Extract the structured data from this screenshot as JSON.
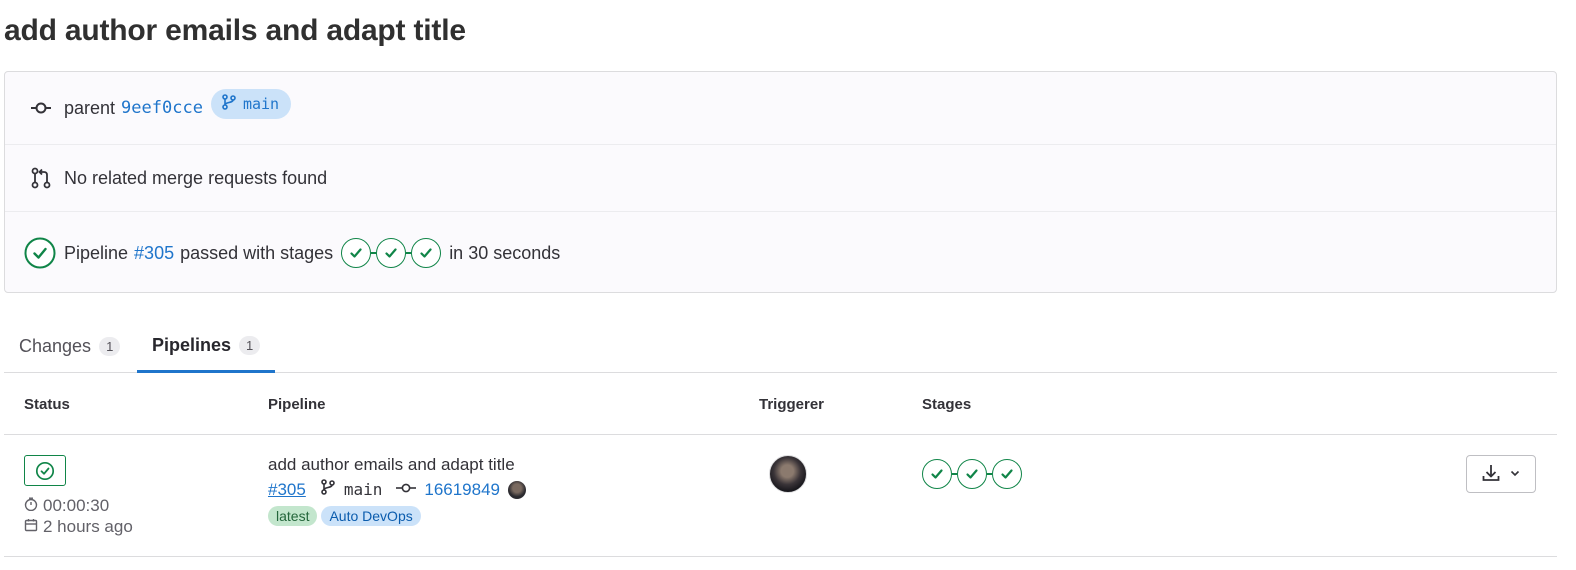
{
  "commit": {
    "title": "add author emails and adapt title",
    "parent_label": "parent",
    "parent_sha": "9eef0cce",
    "branch": "main",
    "merge_requests_text": "No related merge requests found",
    "pipeline_prefix": "Pipeline",
    "pipeline_id": "#305",
    "pipeline_status_text": "passed with stages",
    "pipeline_duration_text": "in 30 seconds"
  },
  "tabs": [
    {
      "label": "Changes",
      "count": "1",
      "active": false
    },
    {
      "label": "Pipelines",
      "count": "1",
      "active": true
    }
  ],
  "table": {
    "headers": {
      "status": "Status",
      "pipeline": "Pipeline",
      "triggerer": "Triggerer",
      "stages": "Stages"
    },
    "rows": [
      {
        "status": "passed",
        "duration": "00:00:30",
        "finished": "2 hours ago",
        "title": "add author emails and adapt title",
        "pipeline_id": "#305",
        "branch": "main",
        "commit_sha": "16619849",
        "labels": [
          "latest",
          "Auto DevOps"
        ]
      }
    ]
  },
  "colors": {
    "success": "#108548",
    "link": "#1f75cb",
    "active_tab": "#1f75cb",
    "label_latest_bg": "#c3e6cd",
    "label_devops_bg": "#cbe2f9"
  },
  "icons": {
    "commit": "commit-icon",
    "branch": "branch-icon",
    "merge_request": "merge-request-icon",
    "status_success": "status-success-icon",
    "clock": "clock-icon",
    "calendar": "calendar-icon",
    "download": "download-icon",
    "chevron": "chevron-down-icon"
  }
}
